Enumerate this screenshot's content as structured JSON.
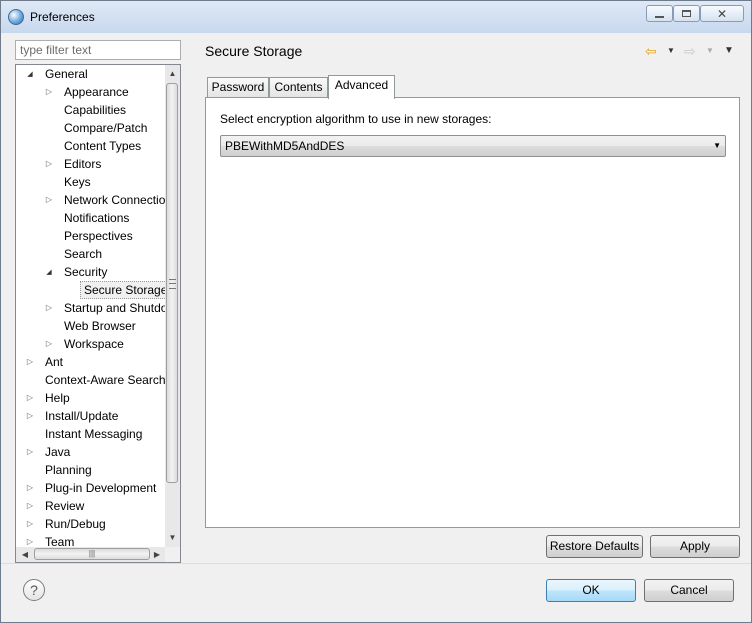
{
  "window": {
    "title": "Preferences"
  },
  "filter": {
    "placeholder": "type filter text",
    "value": ""
  },
  "tree": {
    "items": [
      {
        "label": "General",
        "depth": 0,
        "state": "open"
      },
      {
        "label": "Appearance",
        "depth": 1,
        "state": "closed"
      },
      {
        "label": "Capabilities",
        "depth": 1,
        "state": "leaf"
      },
      {
        "label": "Compare/Patch",
        "depth": 1,
        "state": "leaf"
      },
      {
        "label": "Content Types",
        "depth": 1,
        "state": "leaf"
      },
      {
        "label": "Editors",
        "depth": 1,
        "state": "closed"
      },
      {
        "label": "Keys",
        "depth": 1,
        "state": "leaf"
      },
      {
        "label": "Network Connection",
        "depth": 1,
        "state": "closed"
      },
      {
        "label": "Notifications",
        "depth": 1,
        "state": "leaf"
      },
      {
        "label": "Perspectives",
        "depth": 1,
        "state": "leaf"
      },
      {
        "label": "Search",
        "depth": 1,
        "state": "leaf"
      },
      {
        "label": "Security",
        "depth": 1,
        "state": "open"
      },
      {
        "label": "Secure Storage",
        "depth": 2,
        "state": "leaf",
        "selected": true
      },
      {
        "label": "Startup and Shutdown",
        "depth": 1,
        "state": "closed"
      },
      {
        "label": "Web Browser",
        "depth": 1,
        "state": "leaf"
      },
      {
        "label": "Workspace",
        "depth": 1,
        "state": "closed"
      },
      {
        "label": "Ant",
        "depth": 0,
        "state": "closed"
      },
      {
        "label": "Context-Aware Search",
        "depth": 0,
        "state": "leaf"
      },
      {
        "label": "Help",
        "depth": 0,
        "state": "closed"
      },
      {
        "label": "Install/Update",
        "depth": 0,
        "state": "closed"
      },
      {
        "label": "Instant Messaging",
        "depth": 0,
        "state": "leaf"
      },
      {
        "label": "Java",
        "depth": 0,
        "state": "closed"
      },
      {
        "label": "Planning",
        "depth": 0,
        "state": "leaf"
      },
      {
        "label": "Plug-in Development",
        "depth": 0,
        "state": "closed"
      },
      {
        "label": "Review",
        "depth": 0,
        "state": "closed"
      },
      {
        "label": "Run/Debug",
        "depth": 0,
        "state": "closed"
      },
      {
        "label": "Team",
        "depth": 0,
        "state": "closed"
      }
    ]
  },
  "page": {
    "title": "Secure Storage",
    "tabs": [
      {
        "label": "Password",
        "active": false
      },
      {
        "label": "Contents",
        "active": false
      },
      {
        "label": "Advanced",
        "active": true
      }
    ],
    "algorithm_label": "Select encryption algorithm to use in new storages:",
    "algorithm_value": "PBEWithMD5AndDES"
  },
  "buttons": {
    "restore_defaults": "Restore Defaults",
    "apply": "Apply",
    "ok": "OK",
    "cancel": "Cancel",
    "help": "?"
  },
  "icons": {
    "back": "back-arrow-icon",
    "forward": "forward-arrow-icon",
    "menu": "view-menu-icon",
    "back_color": "#e8a317"
  }
}
